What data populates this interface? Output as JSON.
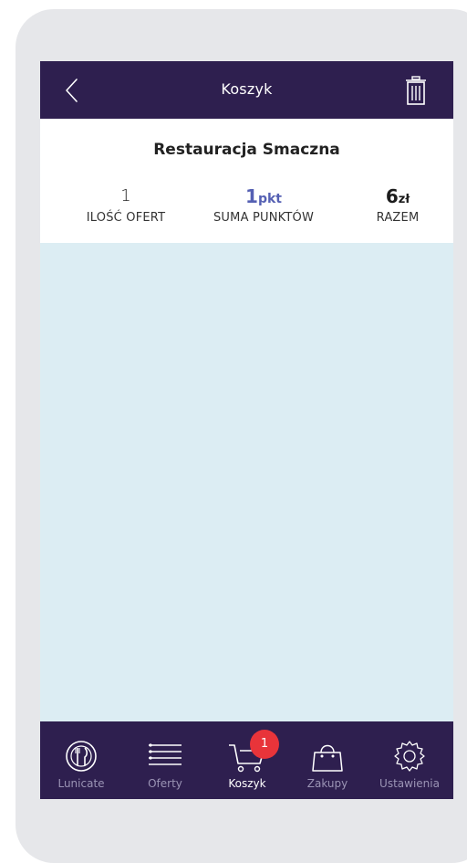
{
  "header": {
    "title": "Koszyk"
  },
  "summary": {
    "restaurant": "Restauracja Smaczna",
    "offers": {
      "value": "1",
      "label": "ILOŚĆ OFERT"
    },
    "points": {
      "value": "1",
      "unit": "pkt",
      "label": "SUMA PUNKTÓW"
    },
    "total": {
      "value": "6",
      "unit": "zł",
      "label": "RAZEM"
    }
  },
  "nav": {
    "items": [
      {
        "label": "Lunicate",
        "icon": "plate-fork-knife-icon",
        "active": false
      },
      {
        "label": "Oferty",
        "icon": "list-icon",
        "active": false
      },
      {
        "label": "Koszyk",
        "icon": "cart-icon",
        "active": true
      },
      {
        "label": "Zakupy",
        "icon": "bag-icon",
        "active": false
      },
      {
        "label": "Ustawienia",
        "icon": "gear-icon",
        "active": false
      }
    ],
    "cart_badge": "1"
  },
  "colors": {
    "bar": "#2e1f4f",
    "content_bg": "#dcedf3",
    "accent_points": "#5560b3",
    "badge": "#e8343a",
    "nav_inactive": "#9b94b5"
  }
}
